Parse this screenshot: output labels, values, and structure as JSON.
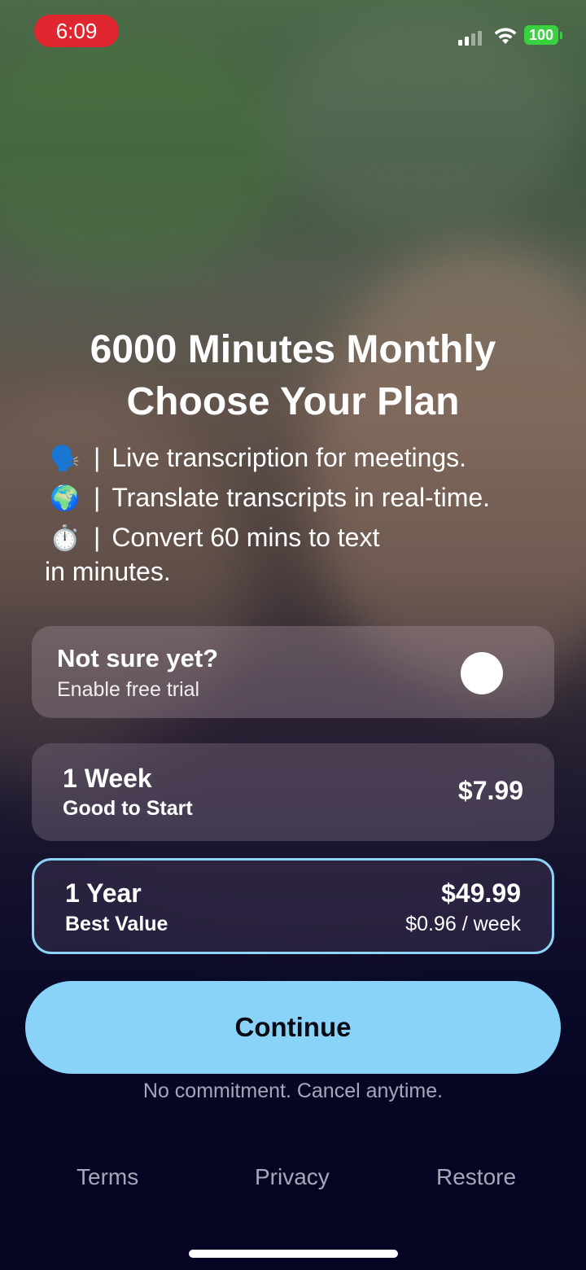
{
  "status_bar": {
    "time": "6:09",
    "battery": "100"
  },
  "headline": {
    "line1": "6000 Minutes Monthly",
    "line2": "Choose Your Plan"
  },
  "features": [
    {
      "icon": "speaking-head-icon",
      "glyph": "🗣️",
      "separator": "|",
      "text": "Live transcription for meetings."
    },
    {
      "icon": "globe-icon",
      "glyph": "🌍",
      "separator": "|",
      "text": "Translate transcripts in real-time."
    },
    {
      "icon": "stopwatch-icon",
      "glyph": "⏱️",
      "separator": "|",
      "text": "Convert 60 mins to text",
      "continuation": "in minutes."
    }
  ],
  "trial": {
    "title": "Not sure yet?",
    "subtitle": "Enable free trial",
    "enabled": false
  },
  "plans": {
    "week": {
      "name": "1 Week",
      "tagline": "Good to Start",
      "price": "$7.99"
    },
    "year": {
      "name": "1 Year",
      "tagline": "Best Value",
      "price": "$49.99",
      "per_week": "$0.96 / week",
      "selected": true
    }
  },
  "cta": {
    "label": "Continue",
    "note": "No commitment. Cancel anytime."
  },
  "footer": {
    "terms": "Terms",
    "privacy": "Privacy",
    "restore": "Restore"
  },
  "colors": {
    "accent": "#89d3f8",
    "selected_border": "#8fd3f7",
    "recording_pill": "#e0262e",
    "battery": "#38d13f"
  }
}
